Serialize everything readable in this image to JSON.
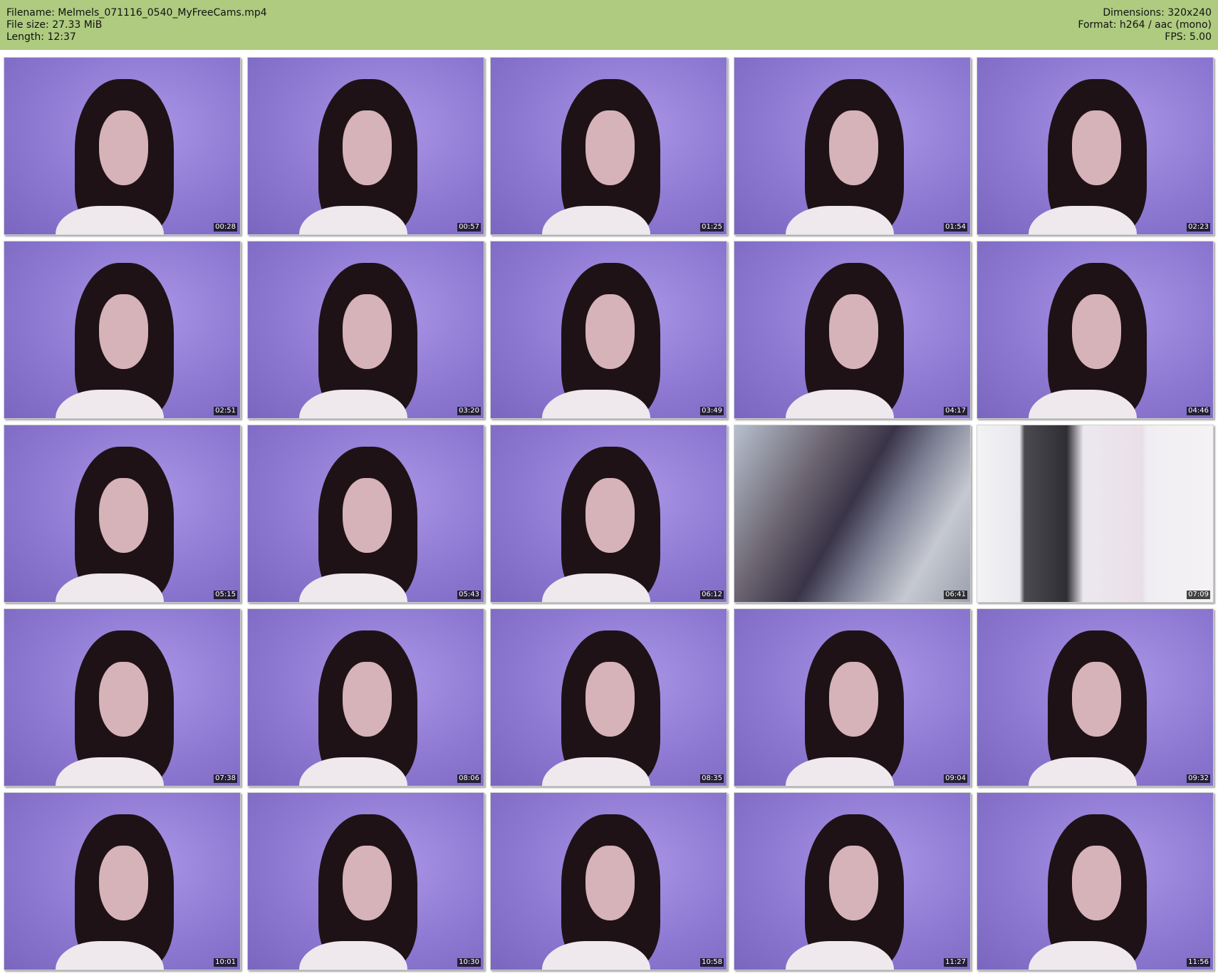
{
  "header": {
    "filename": "Filename: Melmels_071116_0540_MyFreeCams.mp4",
    "file_size": "File size: 27.33 MiB",
    "length": "Length: 12:37",
    "dimensions": "Dimensions: 320x240",
    "format": "Format: h264 / aac (mono)",
    "fps": "FPS: 5.00"
  },
  "colors": {
    "header_background": "#aecb80",
    "page_background": "#ffffff"
  },
  "thumbnails": [
    {
      "timestamp": "00:28",
      "scene": "purple"
    },
    {
      "timestamp": "00:57",
      "scene": "purple"
    },
    {
      "timestamp": "01:25",
      "scene": "purple"
    },
    {
      "timestamp": "01:54",
      "scene": "purple"
    },
    {
      "timestamp": "02:23",
      "scene": "purple"
    },
    {
      "timestamp": "02:51",
      "scene": "purple"
    },
    {
      "timestamp": "03:20",
      "scene": "purple"
    },
    {
      "timestamp": "03:49",
      "scene": "purple"
    },
    {
      "timestamp": "04:17",
      "scene": "purple"
    },
    {
      "timestamp": "04:46",
      "scene": "purple"
    },
    {
      "timestamp": "05:15",
      "scene": "purple"
    },
    {
      "timestamp": "05:43",
      "scene": "purple"
    },
    {
      "timestamp": "06:12",
      "scene": "purple"
    },
    {
      "timestamp": "06:41",
      "scene": "blur"
    },
    {
      "timestamp": "07:09",
      "scene": "closet"
    },
    {
      "timestamp": "07:38",
      "scene": "purple"
    },
    {
      "timestamp": "08:06",
      "scene": "purple"
    },
    {
      "timestamp": "08:35",
      "scene": "purple"
    },
    {
      "timestamp": "09:04",
      "scene": "purple"
    },
    {
      "timestamp": "09:32",
      "scene": "purple"
    },
    {
      "timestamp": "10:01",
      "scene": "purple"
    },
    {
      "timestamp": "10:30",
      "scene": "purple"
    },
    {
      "timestamp": "10:58",
      "scene": "purple"
    },
    {
      "timestamp": "11:27",
      "scene": "purple"
    },
    {
      "timestamp": "11:56",
      "scene": "purple"
    }
  ]
}
